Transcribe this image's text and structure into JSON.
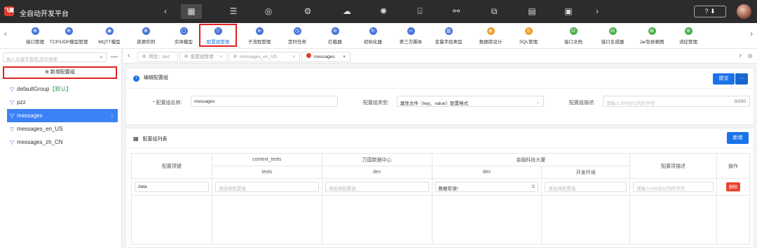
{
  "app": {
    "logo": "飞翼",
    "title": "全自动开发平台"
  },
  "topbar": {
    "nav_left": "‹",
    "nav_right": "›",
    "icons": [
      {
        "name": "dashboard-icon",
        "glyph": "▦",
        "active": true
      },
      {
        "name": "list-icon",
        "glyph": "☰"
      },
      {
        "name": "target-icon",
        "glyph": "◎"
      },
      {
        "name": "gear-icon",
        "glyph": "⚙"
      },
      {
        "name": "cloud-icon",
        "glyph": "☁"
      },
      {
        "name": "openai-icon",
        "glyph": "✺"
      },
      {
        "name": "code-box-icon",
        "glyph": "⌸"
      },
      {
        "name": "link-icon",
        "glyph": "⚯"
      },
      {
        "name": "copy-icon",
        "glyph": "⧉"
      },
      {
        "name": "clipboard-icon",
        "glyph": "▤"
      },
      {
        "name": "settings-box-icon",
        "glyph": "▣"
      }
    ],
    "help_label": "? ⬇"
  },
  "ribbon": {
    "left_arrow": "‹",
    "right_arrow": "›",
    "items": [
      {
        "label": "接口管理",
        "color": "#4a76d9",
        "glyph": "⊕"
      },
      {
        "label": "TCP/UDP模型管理",
        "color": "#4a76d9",
        "glyph": "⊕"
      },
      {
        "label": "MQTT模型",
        "color": "#4a76d9",
        "glyph": "◉"
      },
      {
        "label": "资源实例",
        "color": "#4a76d9",
        "glyph": "⊗"
      },
      {
        "label": "实体模型",
        "color": "#4a76d9",
        "glyph": "▢"
      },
      {
        "label": "配置组管理",
        "color": "#4a76d9",
        "glyph": "▽",
        "active": true
      },
      {
        "label": "子流程管理",
        "color": "#4a76d9",
        "glyph": "⊳"
      },
      {
        "label": "定时任务",
        "color": "#4a76d9",
        "glyph": "◷"
      },
      {
        "label": "拦截器",
        "color": "#4a76d9",
        "glyph": "⊘"
      },
      {
        "label": "初始化器",
        "color": "#4a76d9",
        "glyph": "↻"
      },
      {
        "label": "第三方脚本",
        "color": "#4a76d9",
        "glyph": "‹›"
      },
      {
        "label": "变量字段类型",
        "color": "#4a76d9",
        "glyph": "▥"
      },
      {
        "label": "数据库设计",
        "color": "#f0a030",
        "glyph": "◈"
      },
      {
        "label": "SQL管理",
        "color": "#f0a030",
        "glyph": "S"
      },
      {
        "label": "接口文档",
        "color": "#4caf50",
        "glyph": "⊡"
      },
      {
        "label": "接口生成器",
        "color": "#4caf50",
        "glyph": "⊟"
      },
      {
        "label": "Jar包依赖图",
        "color": "#4caf50",
        "glyph": "⊞"
      },
      {
        "label": "流控管理",
        "color": "#4caf50",
        "glyph": "⊚"
      }
    ]
  },
  "sidebar": {
    "search_placeholder": "输入关键字查询,回车搜索",
    "search_icon": "⌕",
    "collapse_icon": "—",
    "new_group": "⊕  新增配置组",
    "items": [
      {
        "label": "defaultGroup",
        "tag": "【默认】"
      },
      {
        "label": "pzz",
        "tag": ""
      },
      {
        "label": "messages",
        "tag": "",
        "selected": true
      },
      {
        "label": "messages_en_US",
        "tag": ""
      },
      {
        "label": "messages_zh_CN",
        "tag": ""
      }
    ]
  },
  "tabs": {
    "nav_left": "‹",
    "nav_right": "›",
    "close_all": "⊗",
    "items": [
      {
        "label": "项目：test",
        "closable": false
      },
      {
        "label": "配置组管理",
        "closable": true
      },
      {
        "label": "messages_en_US",
        "closable": true
      },
      {
        "label": "messages",
        "closable": true,
        "active": true
      }
    ]
  },
  "edit": {
    "title": "编辑配置组",
    "submit": "提交",
    "more": "···",
    "name_label": "配置组名称:",
    "name_value": "messages",
    "type_label": "配置组类型:",
    "type_value": "属性文件（key、value）配置格式",
    "desc_label": "配置组描述:",
    "desc_placeholder": "请输入200位以内的字符",
    "desc_count": "0/200"
  },
  "list": {
    "title": "配置组列表",
    "new_button": "新增",
    "headers": {
      "key": "配置项键",
      "desc": "配置项描述",
      "op": "操作"
    },
    "groups": [
      {
        "name": "context_tests",
        "env": "tests"
      },
      {
        "name": "万国数据中心",
        "env": "dev"
      },
      {
        "name": "金融科技大厦",
        "env": "dev"
      },
      {
        "name": "",
        "env": "开发环境"
      }
    ],
    "row": {
      "key": "data",
      "v1": "请选择配置值",
      "v2": "请选择配置值",
      "v3": "数据有误!",
      "v4": "请选择配置值",
      "desc": "请输入200位以内的字符",
      "delete": "删除"
    }
  }
}
